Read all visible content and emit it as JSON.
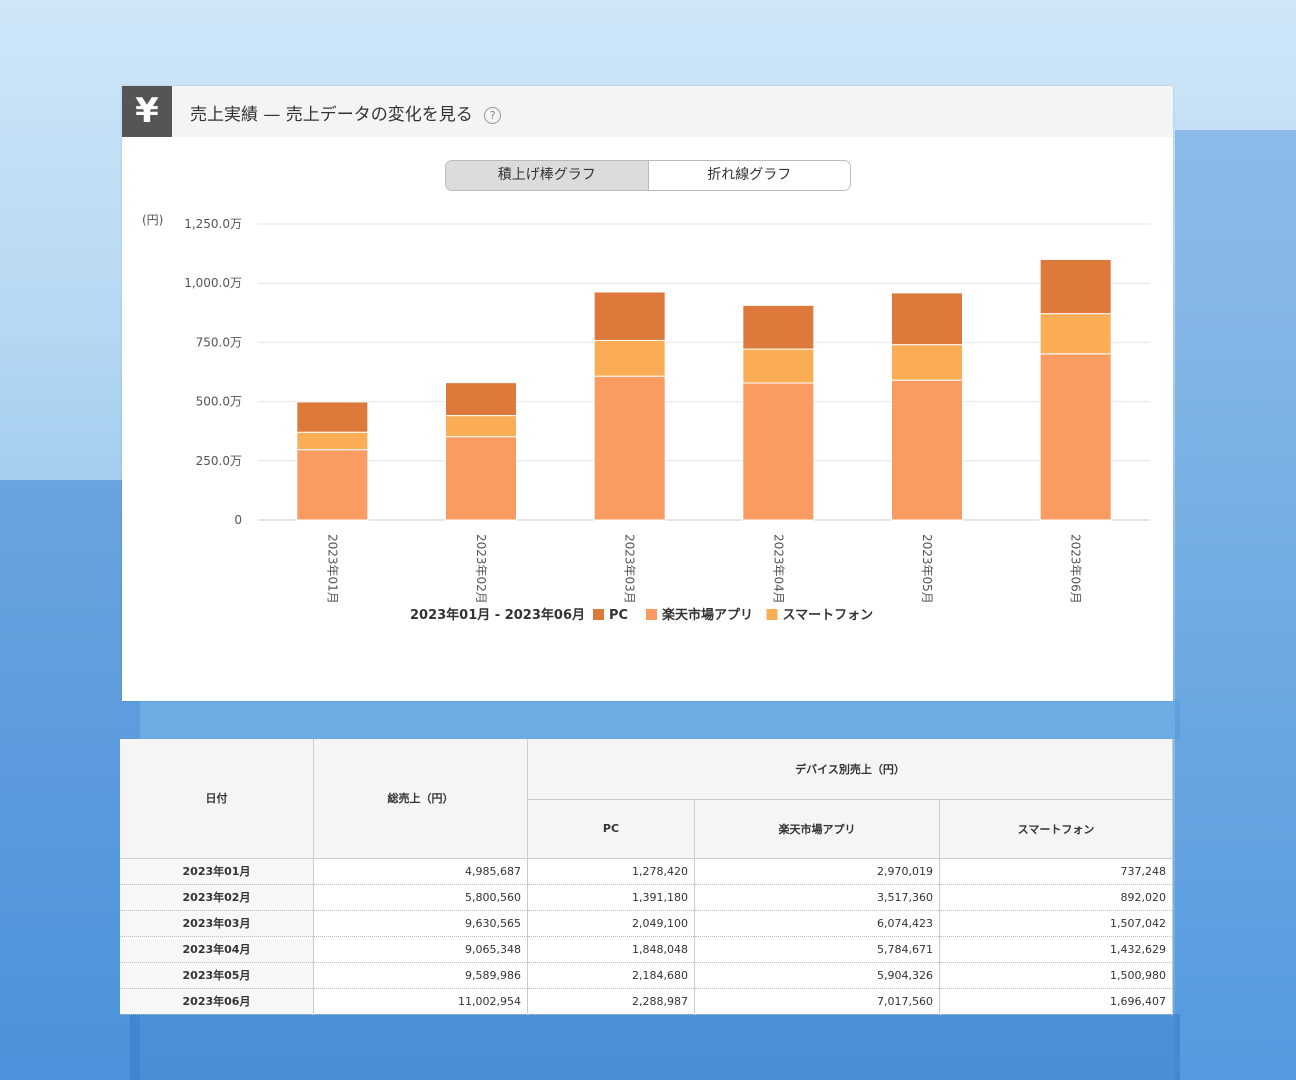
{
  "header": {
    "icon": "yen-icon",
    "icon_glyph": "¥",
    "title": "売上実績 — 売上データの変化を見る",
    "help": "?"
  },
  "toggle": {
    "bar_label": "積上げ棒グラフ",
    "line_label": "折れ線グラフ",
    "selected": "bar"
  },
  "chart_data": {
    "type": "bar",
    "stacked": true,
    "unit_label": "(円)",
    "categories": [
      "2023年01月",
      "2023年02月",
      "2023年03月",
      "2023年04月",
      "2023年05月",
      "2023年06月"
    ],
    "y_ticks": [
      "0",
      "250.0万",
      "500.0万",
      "750.0万",
      "1,000.0万",
      "1,250.0万"
    ],
    "ylim": [
      0,
      12500000
    ],
    "series": [
      {
        "name": "楽天市場アプリ",
        "color": "#fa9c62",
        "values": [
          2970019,
          3517360,
          6074423,
          5784671,
          5904326,
          7017560
        ]
      },
      {
        "name": "スマートフォン",
        "color": "#fbad55",
        "values": [
          737248,
          892020,
          1507042,
          1432629,
          1500980,
          1696407
        ]
      },
      {
        "name": "PC",
        "color": "#dd7a3b",
        "values": [
          1278420,
          1391180,
          2049100,
          1848048,
          2184680,
          2288987
        ]
      }
    ],
    "legend_order": [
      "PC",
      "楽天市場アプリ",
      "スマートフォン"
    ],
    "range_label": "2023年01月 - 2023年06月",
    "grid": true,
    "legend_position": "bottom"
  },
  "table": {
    "headers": {
      "date": "日付",
      "total": "総売上（円）",
      "device_group": "デバイス別売上（円）",
      "pc": "PC",
      "app": "楽天市場アプリ",
      "smartphone": "スマートフォン"
    },
    "rows": [
      {
        "date": "2023年01月",
        "total": "4,985,687",
        "pc": "1,278,420",
        "app": "2,970,019",
        "smartphone": "737,248"
      },
      {
        "date": "2023年02月",
        "total": "5,800,560",
        "pc": "1,391,180",
        "app": "3,517,360",
        "smartphone": "892,020"
      },
      {
        "date": "2023年03月",
        "total": "9,630,565",
        "pc": "2,049,100",
        "app": "6,074,423",
        "smartphone": "1,507,042"
      },
      {
        "date": "2023年04月",
        "total": "9,065,348",
        "pc": "1,848,048",
        "app": "5,784,671",
        "smartphone": "1,432,629"
      },
      {
        "date": "2023年05月",
        "total": "9,589,986",
        "pc": "2,184,680",
        "app": "5,904,326",
        "smartphone": "1,500,980"
      },
      {
        "date": "2023年06月",
        "total": "11,002,954",
        "pc": "2,288,987",
        "app": "7,017,560",
        "smartphone": "1,696,407"
      }
    ]
  }
}
